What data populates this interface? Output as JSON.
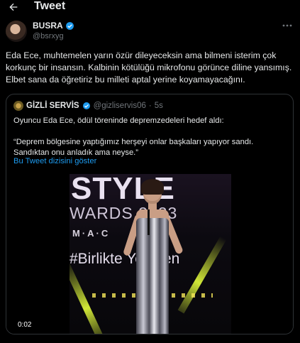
{
  "header": {
    "title": "Tweet"
  },
  "author": {
    "name": "BUSRA",
    "handle": "@bsrxyg"
  },
  "tweet": {
    "text": "Eda Ece, muhtemelen yarın özür dileyeceksin ama bilmeni isterim çok korkunç bir insansın. Kalbinin kötülüğü mikrofonu görünce diline yansımış. Elbet sana da öğretiriz bu milleti aptal yerine koyamayacağını."
  },
  "quoted_tweet": {
    "name": "GİZLİ SERVİS",
    "handle": "@gizliservis06",
    "separator": "·",
    "time": "5s",
    "text": "Oyuncu Eda Ece, ödül töreninde depremzedeleri hedef aldı:\n\n“Deprem bölgesine yaptığımız herşeyi onlar başkaları yapıyor sandı. Sandıktan onu anladık ama neyse.”",
    "thread_link": "Bu Tweet dizisini göster",
    "video": {
      "overlay_text_1": "STYLE",
      "overlay_text_2": "WARDS 2023",
      "overlay_text_3": "M·A·C",
      "overlay_text_4": "#Birlikte Yeniden",
      "duration": "0:02"
    }
  },
  "colors": {
    "background": "#000000",
    "text": "#e7e9ea",
    "secondary": "#71767b",
    "accent": "#1d9bf0",
    "border": "#2f3336"
  },
  "icons": {
    "back": "arrow-left-icon",
    "verified": "verified-badge-icon",
    "more": "more-horizontal-icon"
  }
}
